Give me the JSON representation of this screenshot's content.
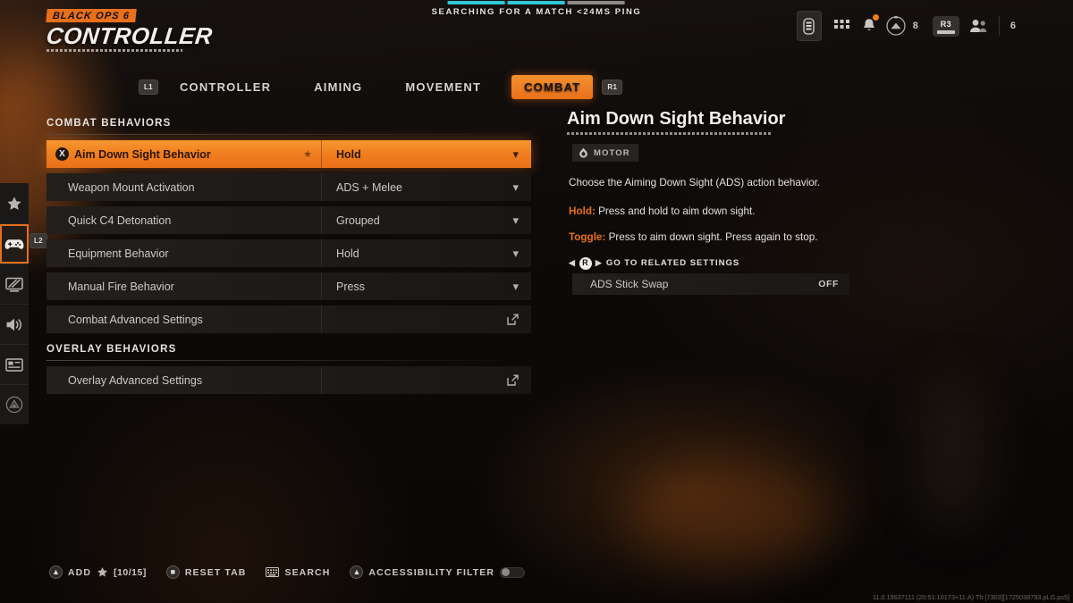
{
  "header": {
    "brand_sub": "BLACK OPS 6",
    "brand_title": "CONTROLLER",
    "match_status": "SEARCHING FOR A MATCH <24MS PING",
    "accent_color": "#e8701a",
    "progress_color": "#2ec8d6"
  },
  "topright": {
    "battery_icon": "battery-icon",
    "apps_icon": "grid-apps-icon",
    "notifications_icon": "bell-icon",
    "notification_badge": true,
    "currency_icon": "cod-points-icon",
    "currency_value": "8",
    "r3_label": "R3",
    "friends_icon": "friends-icon",
    "friends_value": "6"
  },
  "sidebar": {
    "items": [
      {
        "name": "favorites",
        "icon": "star-icon",
        "active": false
      },
      {
        "name": "controller",
        "icon": "gamepad-icon",
        "active": true,
        "badge": "L2"
      },
      {
        "name": "graphics",
        "icon": "display-icon",
        "active": false
      },
      {
        "name": "audio",
        "icon": "speaker-icon",
        "active": false
      },
      {
        "name": "interface",
        "icon": "interface-icon",
        "active": false
      },
      {
        "name": "network",
        "icon": "network-icon",
        "active": false
      }
    ]
  },
  "tabs": {
    "left_bumper": "L1",
    "right_bumper": "R1",
    "items": [
      {
        "label": "CONTROLLER",
        "active": false
      },
      {
        "label": "AIMING",
        "active": false
      },
      {
        "label": "MOVEMENT",
        "active": false
      },
      {
        "label": "COMBAT",
        "active": true
      }
    ]
  },
  "settings": {
    "groups": [
      {
        "title": "COMBAT BEHAVIORS",
        "rows": [
          {
            "label": "Aim Down Sight Behavior",
            "value": "Hold",
            "control": "dropdown",
            "selected": true,
            "starred": true,
            "button_hint": "X"
          },
          {
            "label": "Weapon Mount Activation",
            "value": "ADS + Melee",
            "control": "dropdown",
            "selected": false
          },
          {
            "label": "Quick C4 Detonation",
            "value": "Grouped",
            "control": "dropdown",
            "selected": false
          },
          {
            "label": "Equipment Behavior",
            "value": "Hold",
            "control": "dropdown",
            "selected": false
          },
          {
            "label": "Manual Fire Behavior",
            "value": "Press",
            "control": "dropdown",
            "selected": false
          },
          {
            "label": "Combat Advanced Settings",
            "value": "",
            "control": "submenu",
            "selected": false
          }
        ]
      },
      {
        "title": "OVERLAY BEHAVIORS",
        "rows": [
          {
            "label": "Overlay Advanced Settings",
            "value": "",
            "control": "submenu",
            "selected": false
          }
        ]
      }
    ]
  },
  "detail": {
    "title": "Aim Down Sight Behavior",
    "tag": "MOTOR",
    "tag_icon": "accessibility-motor-icon",
    "description": "Choose the Aiming Down Sight (ADS) action behavior.",
    "options": [
      {
        "key": "Hold:",
        "text": "Press and hold to aim down sight."
      },
      {
        "key": "Toggle:",
        "text": "Press to aim down sight. Press again to stop."
      }
    ],
    "related_label": "GO TO RELATED SETTINGS",
    "related_button": "R",
    "related_rows": [
      {
        "label": "ADS Stick Swap",
        "value": "OFF"
      }
    ]
  },
  "actions": [
    {
      "button": "A",
      "icon": "triangle-button-icon",
      "label": "ADD",
      "star": true,
      "count": "[10/15]"
    },
    {
      "button": "B",
      "icon": "square-button-icon",
      "label": "RESET TAB"
    },
    {
      "button": "",
      "icon": "keyboard-icon",
      "label": "SEARCH"
    },
    {
      "button": "A",
      "icon": "triangle-button-icon",
      "label": "ACCESSIBILITY FILTER",
      "toggle": "off"
    }
  ],
  "build_string": "11.0.19637111 (20:51:10173+11:A) Th [7303][1725038793.pLG.ps5]"
}
